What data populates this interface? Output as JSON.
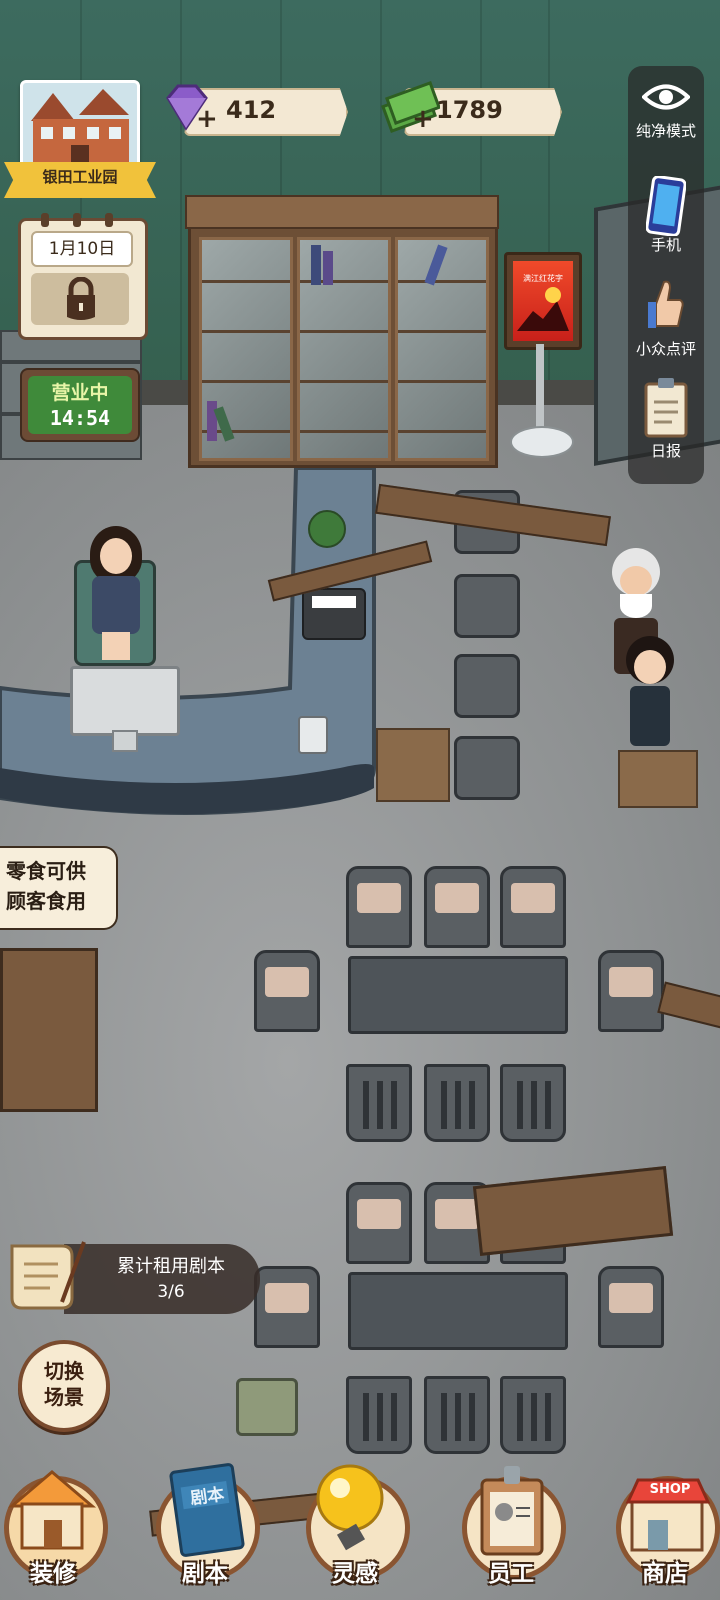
{
  "header": {
    "location_name": "银田工业园",
    "gems": "412",
    "cash": "1789"
  },
  "calendar": {
    "date": "1月10日"
  },
  "business": {
    "status": "营业中",
    "time": "14:54"
  },
  "side_menu": [
    {
      "label": "纯净模式",
      "icon": "eye-icon"
    },
    {
      "label": "手机",
      "icon": "phone-icon"
    },
    {
      "label": "小众点评",
      "icon": "thumbs-up-icon"
    },
    {
      "label": "日报",
      "icon": "clipboard-icon"
    }
  ],
  "poster": {
    "title": "满江红花字"
  },
  "notice": {
    "line1": "零食可供",
    "line2": "顾客食用"
  },
  "script_progress": {
    "label": "累计租用剧本",
    "count": "3/6"
  },
  "switch_scene": {
    "line1": "切换",
    "line2": "场景"
  },
  "bottom_nav": [
    {
      "label": "装修",
      "icon": "house-icon"
    },
    {
      "label": "剧本",
      "icon": "script-book-icon",
      "badge": "剧本"
    },
    {
      "label": "灵感",
      "icon": "lightbulb-icon"
    },
    {
      "label": "员工",
      "icon": "staff-id-card-icon"
    },
    {
      "label": "商店",
      "icon": "shop-icon",
      "badge": "SHOP"
    }
  ],
  "colors": {
    "wall": "#3d6b5f",
    "floor": "#8f9294",
    "open_green": "#3f8a3a",
    "gem_purple": "#8b5cc9",
    "cash_green": "#5aa845",
    "nav_ring": "#8a5531"
  }
}
